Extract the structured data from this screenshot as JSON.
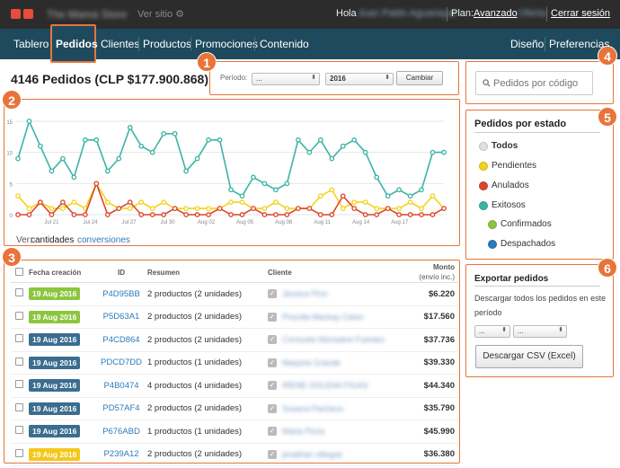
{
  "topbar": {
    "store_name": "The Mamá Store",
    "view_site": "Ver sitio",
    "hello": "Hola",
    "user_name": "Juan Pablo Aguanique",
    "plan_label": "Plan:",
    "plan_link": "Avanzado",
    "plan_badge": "Oferta",
    "logout": "Cerrar sesión"
  },
  "nav": {
    "items": [
      "Tablero",
      "Pedidos",
      "Clientes",
      "Productos",
      "Promociones",
      "Contenido"
    ],
    "right": [
      "Diseño",
      "Preferencias"
    ],
    "active": "Pedidos"
  },
  "badges": [
    "1",
    "2",
    "3",
    "4",
    "5",
    "6"
  ],
  "main": {
    "title": "4146 Pedidos (CLP $177.900.868)",
    "period_label": "Período:",
    "period_select": "...",
    "year_select": "2016",
    "change_button": "Cambiar"
  },
  "search": {
    "placeholder": "Pedidos por código"
  },
  "view": {
    "label": "Ver:",
    "quantities": "cantidades",
    "conversions": "conversiones"
  },
  "chart_data": {
    "type": "line",
    "x": [
      "Jul 18",
      "Jul 19",
      "Jul 20",
      "Jul 21",
      "Jul 22",
      "Jul 23",
      "Jul 24",
      "Jul 25",
      "Jul 26",
      "Jul 27",
      "Jul 28",
      "Jul 29",
      "Jul 30",
      "Jul 31",
      "Aug 01",
      "Aug 02",
      "Aug 03",
      "Aug 04",
      "Aug 05",
      "Aug 06",
      "Aug 07",
      "Aug 08",
      "Aug 09",
      "Aug 10",
      "Aug 11",
      "Aug 12",
      "Aug 13",
      "Aug 14",
      "Aug 15",
      "Aug 16",
      "Aug 17",
      "Aug 18"
    ],
    "tick_labels": [
      "Jul 21",
      "Jul 24",
      "Jul 27",
      "Jul 30",
      "Aug 02",
      "Aug 05",
      "Aug 08",
      "Aug 11",
      "Aug 14",
      "Aug 17"
    ],
    "yticks": [
      0,
      5,
      10,
      15
    ],
    "ylim": [
      0,
      16
    ],
    "grid": true,
    "series": [
      {
        "color": "#3bb3a5",
        "values": [
          9,
          15,
          11,
          7,
          9,
          6,
          12,
          12,
          7,
          9,
          14,
          11,
          10,
          13,
          13,
          7,
          9,
          12,
          12,
          4,
          3,
          6,
          5,
          4,
          5,
          12,
          10,
          12,
          9,
          11,
          12,
          10,
          6,
          3,
          4,
          3,
          4,
          10,
          10
        ]
      },
      {
        "color": "#f4d21b",
        "values": [
          3,
          1,
          2,
          1,
          1,
          2,
          1,
          5,
          2,
          1,
          1,
          2,
          1,
          2,
          1,
          1,
          1,
          1,
          1,
          2,
          2,
          1,
          1,
          2,
          1,
          1,
          1,
          3,
          4,
          1,
          2,
          2,
          1,
          1,
          1,
          2,
          1,
          3,
          1
        ]
      },
      {
        "color": "#d9472b",
        "values": [
          0,
          0,
          2,
          0,
          2,
          0,
          0,
          5,
          0,
          1,
          2,
          0,
          0,
          0,
          1,
          0,
          0,
          0,
          1,
          0,
          0,
          1,
          0,
          0,
          0,
          1,
          1,
          0,
          0,
          3,
          1,
          0,
          0,
          1,
          0,
          0,
          0,
          0,
          1
        ]
      }
    ]
  },
  "table": {
    "headers": [
      "Fecha creación",
      "ID",
      "Resumen",
      "Cliente",
      "Monto",
      "(envío inc.)"
    ],
    "rows": [
      {
        "date": "19 Aug 2016",
        "date_color": "#8cc63f",
        "id": "P4D95BB",
        "summary": "2 productos (2 unidades)",
        "client": "Jessica Pino",
        "amount": "$6.220"
      },
      {
        "date": "19 Aug 2016",
        "date_color": "#8cc63f",
        "id": "P5D63A1",
        "summary": "2 productos (2 unidades)",
        "client": "Priscilla Mackay Celon",
        "amount": "$17.560"
      },
      {
        "date": "19 Aug 2016",
        "date_color": "#3a6d8f",
        "id": "P4CD864",
        "summary": "2 productos (2 unidades)",
        "client": "Consuelo Monsalve Fuentes",
        "amount": "$37.736"
      },
      {
        "date": "19 Aug 2016",
        "date_color": "#3a6d8f",
        "id": "PDCD7DD",
        "summary": "1 productos (1 unidades)",
        "client": "Marjorie Grande",
        "amount": "$39.330"
      },
      {
        "date": "19 Aug 2016",
        "date_color": "#3a6d8f",
        "id": "P4B0474",
        "summary": "4 productos (4 unidades)",
        "client": "IRENE SOLENA FIGAS",
        "amount": "$44.340"
      },
      {
        "date": "19 Aug 2016",
        "date_color": "#3a6d8f",
        "id": "PD57AF4",
        "summary": "2 productos (2 unidades)",
        "client": "Susana Pacheco",
        "amount": "$35.790"
      },
      {
        "date": "19 Aug 2016",
        "date_color": "#3a6d8f",
        "id": "P676ABD",
        "summary": "1 productos (1 unidades)",
        "client": "Maria Pizza",
        "amount": "$45.990"
      },
      {
        "date": "19 Aug 2016",
        "date_color": "#f4c81b",
        "id": "P239A12",
        "summary": "2 productos (2 unidades)",
        "client": "jonathan villegas",
        "amount": "$36.380"
      }
    ]
  },
  "states": {
    "title": "Pedidos por estado",
    "items": [
      {
        "label": "Todos",
        "color": "#e0e0e0"
      },
      {
        "label": "Pendientes",
        "color": "#f4d21b"
      },
      {
        "label": "Anulados",
        "color": "#d9472b"
      },
      {
        "label": "Exitosos",
        "color": "#3bb3a5"
      },
      {
        "label": "Confirmados",
        "color": "#8cc63f"
      },
      {
        "label": "Despachados",
        "color": "#2a7cbd"
      }
    ]
  },
  "export": {
    "title": "Exportar pedidos",
    "description": "Descargar todos los pedidos en este período",
    "select1": "...",
    "select2": "...",
    "button": "Descargar CSV (Excel)"
  }
}
